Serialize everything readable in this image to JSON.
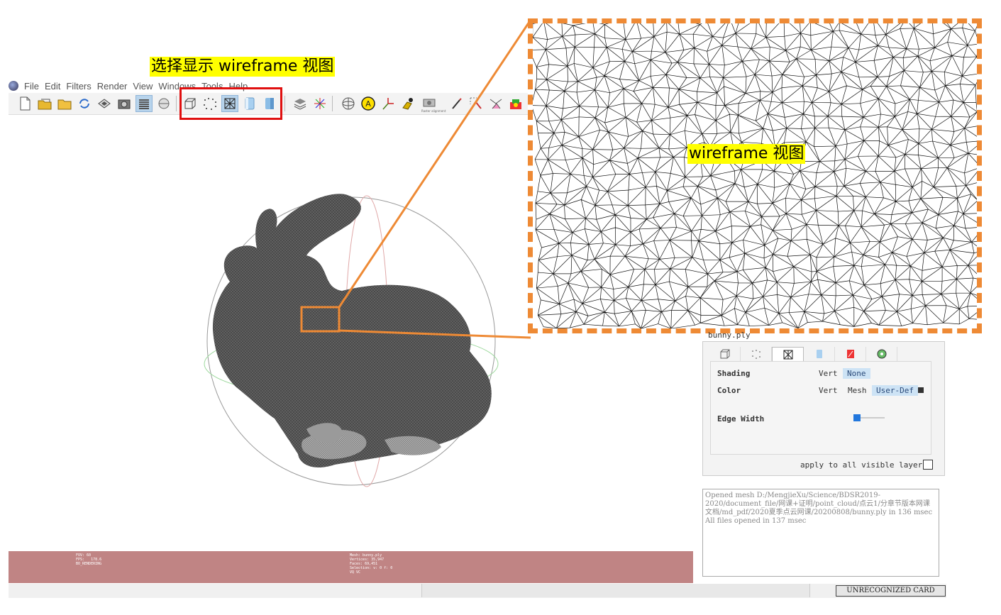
{
  "annotations": {
    "select_label": "选择显示 wireframe 视图",
    "zoom_label": "wireframe 视图"
  },
  "menu": {
    "app_icon": "meshlab-icon",
    "items": [
      "File",
      "Edit",
      "Filters",
      "Render",
      "View",
      "Windows",
      "Tools",
      "Help"
    ]
  },
  "toolbar": {
    "icons": [
      "new-icon",
      "open-project-icon",
      "open-icon",
      "reload-icon",
      "save-icon",
      "snapshot-icon",
      "layers-icon",
      "bbox-icon",
      "bbox-mode-icon",
      "points-mode-icon",
      "wireframe-mode-icon",
      "flat-mode-icon",
      "smooth-mode-icon",
      "layers-stack-icon",
      "axes-icon",
      "trackball-icon",
      "annotation-icon",
      "measure-icon",
      "color-icon",
      "camera-icon",
      "paint-icon",
      "select-icon",
      "tools-icon",
      "texture-icon"
    ],
    "camera_caption": "Raster alignment"
  },
  "right_panel": {
    "layer_name": "bunny.ply",
    "mode_icons": [
      "bbox-icon",
      "points-icon",
      "wireframe-icon",
      "flat-icon",
      "texture-icon",
      "options-icon"
    ],
    "shading": {
      "label": "Shading",
      "options": [
        "Vert",
        "None"
      ],
      "selected": "None"
    },
    "color": {
      "label": "Color",
      "options": [
        "Vert",
        "Mesh",
        "User-Def"
      ],
      "selected": "User-Def",
      "swatch": "#333333"
    },
    "edge_width": {
      "label": "Edge Width",
      "level": 0.1
    },
    "apply_all": "apply to all visible layers"
  },
  "log": {
    "line1": "Opened mesh D:/MengjieXu/Science/BDSR2019-2020/document_file/网课+证明/point_cloud/点云1/分章节版本网课文档/md_pdf/2020夏季点云网课/20200808/bunny.ply in 136 msec",
    "line2": "All files opened in 137 msec"
  },
  "info_bar": {
    "left": "FOV: 60\nFPS:   178.6\nBO_RENDERING",
    "center": "Mesh: bunny.ply\nVertices: 35,947\nFaces: 69,451\nSelection: v: 0 f: 0\nVQ VC"
  },
  "status": {
    "card": "UNRECOGNIZED CARD"
  },
  "colors": {
    "accent_orange": "#ee8a35",
    "highlight_red": "#e01010",
    "info_bar": "#c08484"
  }
}
